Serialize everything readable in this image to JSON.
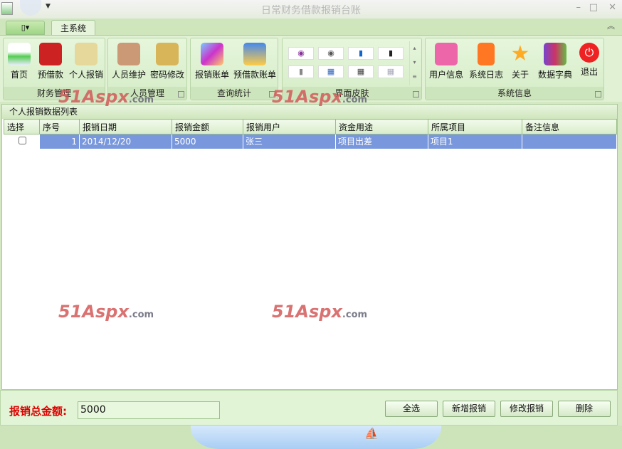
{
  "window": {
    "title": "日常财务借款报销台账",
    "minimize": "–",
    "maximize": "□",
    "close": "✕"
  },
  "tabs": {
    "menu_icon": "▯▾",
    "main": "主系统",
    "collapse": "︽"
  },
  "ribbon": {
    "groups": [
      {
        "label": "财务管理",
        "buttons": [
          "首页",
          "预借款",
          "个人报销"
        ]
      },
      {
        "label": "人员管理",
        "buttons": [
          "人员维护",
          "密码修改"
        ]
      },
      {
        "label": "查询统计",
        "buttons": [
          "报销账单",
          "预借款账单"
        ]
      },
      {
        "label": "界面皮肤",
        "buttons": []
      },
      {
        "label": "系统信息",
        "buttons": [
          "用户信息",
          "系统日志",
          "关于",
          "数据字典",
          "退出"
        ]
      }
    ]
  },
  "panel": {
    "title": "个人报销数据列表"
  },
  "table": {
    "columns": [
      "选择",
      "序号",
      "报销日期",
      "报销金额",
      "报销用户",
      "资金用途",
      "所属项目",
      "备注信息"
    ],
    "rows": [
      {
        "index": "1",
        "date": "2014/12/20",
        "amount": "5000",
        "user": "张三",
        "purpose": "项目出差",
        "project": "项目1",
        "note": ""
      }
    ]
  },
  "footer": {
    "total_label": "报销总金额:",
    "total_value": "5000",
    "buttons": [
      "全选",
      "新增报销",
      "修改报销",
      "删除"
    ]
  },
  "watermark": "51Aspx.com",
  "colors": {
    "selected_row": "#7897dc",
    "total_label": "#dd0000"
  }
}
